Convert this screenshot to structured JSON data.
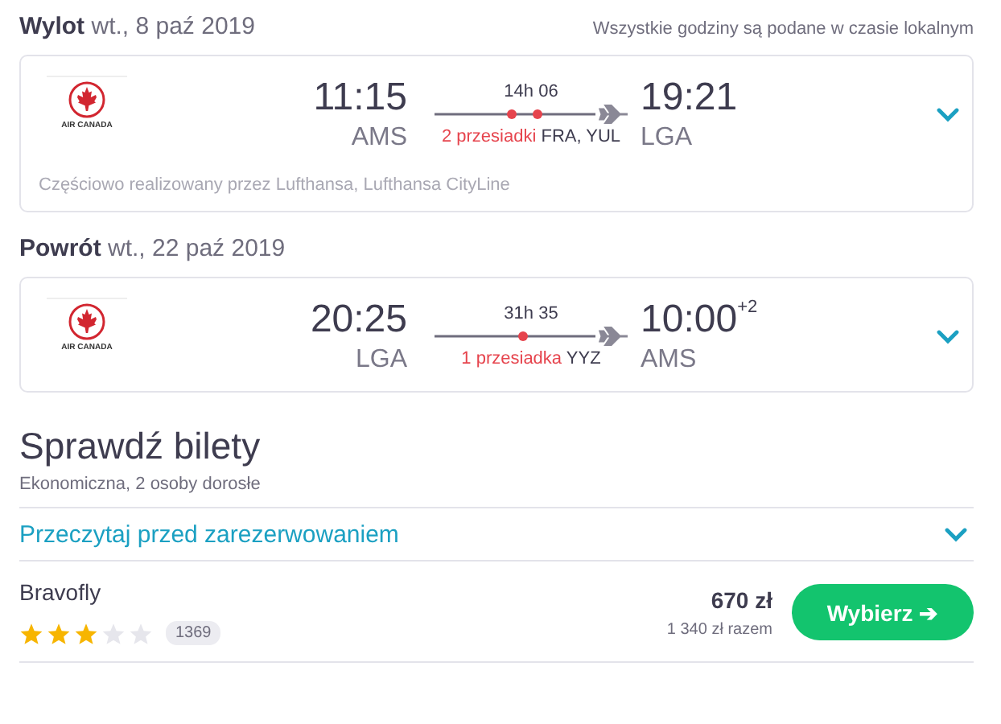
{
  "legs": [
    {
      "label": "Wylot",
      "date": "wt., 8 paź 2019",
      "note": "Wszystkie godziny są podane w czasie lokalnym",
      "airline_logo_text": "AIR CANADA",
      "depart_time": "11:15",
      "depart_airport": "AMS",
      "duration": "14h 06",
      "stops_label": "2 przesiadki",
      "stop_codes": "FRA, YUL",
      "arrive_time": "19:21",
      "arrive_airport": "LGA",
      "operated_by": "Częściowo realizowany przez Lufthansa, Lufthansa CityLine"
    },
    {
      "label": "Powrót",
      "date": "wt., 22 paź 2019",
      "airline_logo_text": "AIR CANADA",
      "depart_time": "20:25",
      "depart_airport": "LGA",
      "duration": "31h 35",
      "stops_label": "1 przesiadka",
      "stop_codes": "YYZ",
      "arrive_time": "10:00",
      "arrive_offset": "+2",
      "arrive_airport": "AMS"
    }
  ],
  "tickets": {
    "title": "Sprawdź bilety",
    "subtitle": "Ekonomiczna, 2 osoby dorosłe",
    "read_before": "Przeczytaj przed zarezerwowaniem",
    "offers": [
      {
        "provider": "Bravofly",
        "stars": 3,
        "reviews": "1369",
        "price": "670 zł",
        "total": "1 340 zł razem",
        "button": "Wybierz ➔"
      }
    ]
  }
}
